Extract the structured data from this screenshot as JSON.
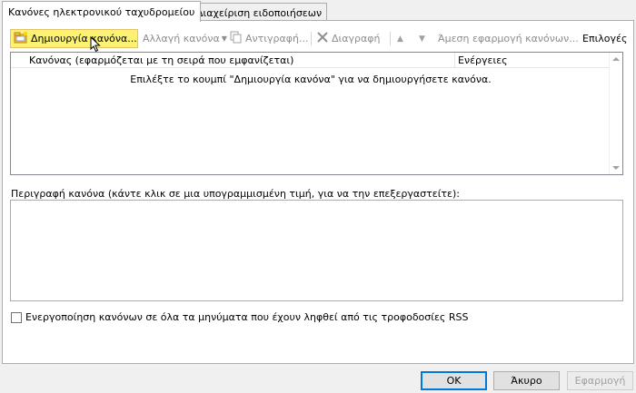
{
  "tabs": [
    {
      "label": "Κανόνες ηλεκτρονικού ταχυδρομείου",
      "active": true
    },
    {
      "label": "Διαχείριση ειδοποιήσεων",
      "active": false
    }
  ],
  "toolbar": {
    "new_rule": "Δημιουργία κανόνα...",
    "change_rule": "Αλλαγή κανόνα",
    "copy": "Αντιγραφή...",
    "delete": "Διαγραφή",
    "run_now": "Άμεση εφαρμογή κανόνων...",
    "options": "Επιλογές"
  },
  "rules_list": {
    "columns": [
      "Κανόνας (εφαρμόζεται με τη σειρά που εμφανίζεται)",
      "Ενέργειες"
    ],
    "empty_message": "Επιλέξτε το κουμπί \"Δημιουργία κανόνα\" για να δημιουργήσετε κανόνα."
  },
  "description": {
    "label": "Περιγραφή κανόνα (κάντε κλικ σε μια υπογραμμισμένη τιμή, για να την επεξεργαστείτε):"
  },
  "rss": {
    "label": "Ενεργοποίηση κανόνων σε όλα τα μηνύματα που έχουν ληφθεί από τις τροφοδοσίες RSS"
  },
  "buttons": {
    "ok": "OK",
    "cancel": "Άκυρο",
    "apply": "Εφαρμογή"
  }
}
